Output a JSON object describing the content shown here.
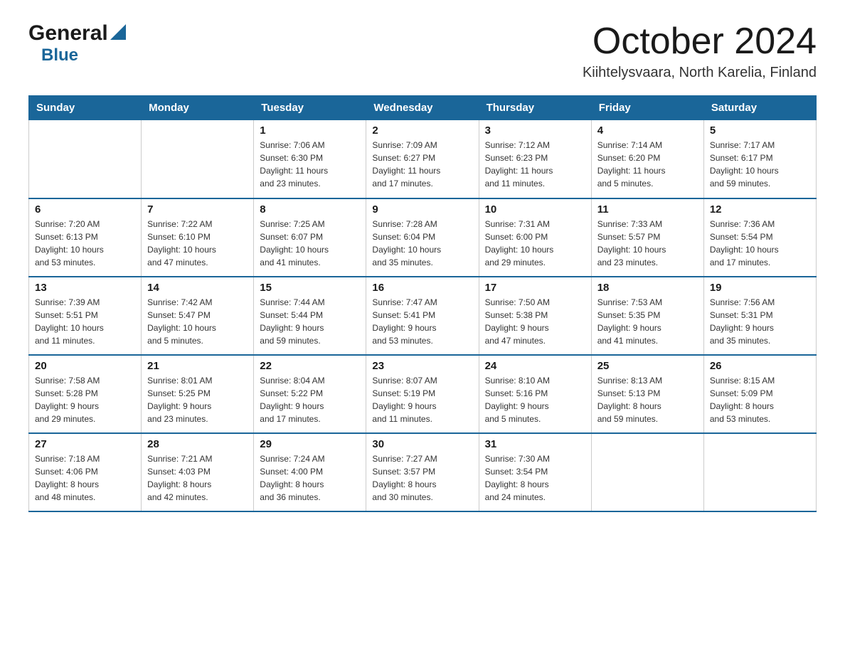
{
  "logo": {
    "general": "General",
    "blue": "Blue",
    "triangle": "▲"
  },
  "title": "October 2024",
  "subtitle": "Kiihtelysvaara, North Karelia, Finland",
  "header_days": [
    "Sunday",
    "Monday",
    "Tuesday",
    "Wednesday",
    "Thursday",
    "Friday",
    "Saturday"
  ],
  "weeks": [
    [
      {
        "day": "",
        "info": ""
      },
      {
        "day": "",
        "info": ""
      },
      {
        "day": "1",
        "info": "Sunrise: 7:06 AM\nSunset: 6:30 PM\nDaylight: 11 hours\nand 23 minutes."
      },
      {
        "day": "2",
        "info": "Sunrise: 7:09 AM\nSunset: 6:27 PM\nDaylight: 11 hours\nand 17 minutes."
      },
      {
        "day": "3",
        "info": "Sunrise: 7:12 AM\nSunset: 6:23 PM\nDaylight: 11 hours\nand 11 minutes."
      },
      {
        "day": "4",
        "info": "Sunrise: 7:14 AM\nSunset: 6:20 PM\nDaylight: 11 hours\nand 5 minutes."
      },
      {
        "day": "5",
        "info": "Sunrise: 7:17 AM\nSunset: 6:17 PM\nDaylight: 10 hours\nand 59 minutes."
      }
    ],
    [
      {
        "day": "6",
        "info": "Sunrise: 7:20 AM\nSunset: 6:13 PM\nDaylight: 10 hours\nand 53 minutes."
      },
      {
        "day": "7",
        "info": "Sunrise: 7:22 AM\nSunset: 6:10 PM\nDaylight: 10 hours\nand 47 minutes."
      },
      {
        "day": "8",
        "info": "Sunrise: 7:25 AM\nSunset: 6:07 PM\nDaylight: 10 hours\nand 41 minutes."
      },
      {
        "day": "9",
        "info": "Sunrise: 7:28 AM\nSunset: 6:04 PM\nDaylight: 10 hours\nand 35 minutes."
      },
      {
        "day": "10",
        "info": "Sunrise: 7:31 AM\nSunset: 6:00 PM\nDaylight: 10 hours\nand 29 minutes."
      },
      {
        "day": "11",
        "info": "Sunrise: 7:33 AM\nSunset: 5:57 PM\nDaylight: 10 hours\nand 23 minutes."
      },
      {
        "day": "12",
        "info": "Sunrise: 7:36 AM\nSunset: 5:54 PM\nDaylight: 10 hours\nand 17 minutes."
      }
    ],
    [
      {
        "day": "13",
        "info": "Sunrise: 7:39 AM\nSunset: 5:51 PM\nDaylight: 10 hours\nand 11 minutes."
      },
      {
        "day": "14",
        "info": "Sunrise: 7:42 AM\nSunset: 5:47 PM\nDaylight: 10 hours\nand 5 minutes."
      },
      {
        "day": "15",
        "info": "Sunrise: 7:44 AM\nSunset: 5:44 PM\nDaylight: 9 hours\nand 59 minutes."
      },
      {
        "day": "16",
        "info": "Sunrise: 7:47 AM\nSunset: 5:41 PM\nDaylight: 9 hours\nand 53 minutes."
      },
      {
        "day": "17",
        "info": "Sunrise: 7:50 AM\nSunset: 5:38 PM\nDaylight: 9 hours\nand 47 minutes."
      },
      {
        "day": "18",
        "info": "Sunrise: 7:53 AM\nSunset: 5:35 PM\nDaylight: 9 hours\nand 41 minutes."
      },
      {
        "day": "19",
        "info": "Sunrise: 7:56 AM\nSunset: 5:31 PM\nDaylight: 9 hours\nand 35 minutes."
      }
    ],
    [
      {
        "day": "20",
        "info": "Sunrise: 7:58 AM\nSunset: 5:28 PM\nDaylight: 9 hours\nand 29 minutes."
      },
      {
        "day": "21",
        "info": "Sunrise: 8:01 AM\nSunset: 5:25 PM\nDaylight: 9 hours\nand 23 minutes."
      },
      {
        "day": "22",
        "info": "Sunrise: 8:04 AM\nSunset: 5:22 PM\nDaylight: 9 hours\nand 17 minutes."
      },
      {
        "day": "23",
        "info": "Sunrise: 8:07 AM\nSunset: 5:19 PM\nDaylight: 9 hours\nand 11 minutes."
      },
      {
        "day": "24",
        "info": "Sunrise: 8:10 AM\nSunset: 5:16 PM\nDaylight: 9 hours\nand 5 minutes."
      },
      {
        "day": "25",
        "info": "Sunrise: 8:13 AM\nSunset: 5:13 PM\nDaylight: 8 hours\nand 59 minutes."
      },
      {
        "day": "26",
        "info": "Sunrise: 8:15 AM\nSunset: 5:09 PM\nDaylight: 8 hours\nand 53 minutes."
      }
    ],
    [
      {
        "day": "27",
        "info": "Sunrise: 7:18 AM\nSunset: 4:06 PM\nDaylight: 8 hours\nand 48 minutes."
      },
      {
        "day": "28",
        "info": "Sunrise: 7:21 AM\nSunset: 4:03 PM\nDaylight: 8 hours\nand 42 minutes."
      },
      {
        "day": "29",
        "info": "Sunrise: 7:24 AM\nSunset: 4:00 PM\nDaylight: 8 hours\nand 36 minutes."
      },
      {
        "day": "30",
        "info": "Sunrise: 7:27 AM\nSunset: 3:57 PM\nDaylight: 8 hours\nand 30 minutes."
      },
      {
        "day": "31",
        "info": "Sunrise: 7:30 AM\nSunset: 3:54 PM\nDaylight: 8 hours\nand 24 minutes."
      },
      {
        "day": "",
        "info": ""
      },
      {
        "day": "",
        "info": ""
      }
    ]
  ]
}
